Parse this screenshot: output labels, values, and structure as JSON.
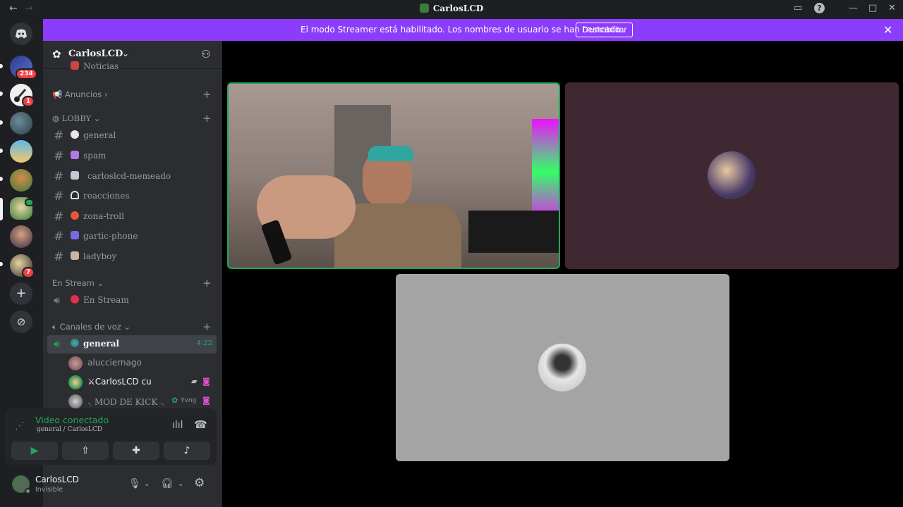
{
  "window": {
    "title": "CarlosLCD"
  },
  "banner": {
    "message": "El modo Streamer está habilitado. Los nombres de usuario se han truncado.",
    "button": "Deshabilitar"
  },
  "rail": {
    "badges": {
      "server1": "234",
      "server2": "1",
      "server8": "7"
    }
  },
  "server": {
    "name": "CarlosLCD"
  },
  "sidebar": {
    "partial_channel": "Noticias",
    "categories": {
      "anuncios": "Anuncios",
      "lobby": "LOBBY",
      "stream": "En Stream",
      "voz": "Canales de voz"
    },
    "channels": [
      {
        "label": "general"
      },
      {
        "label": "spam"
      },
      {
        "label": "carloslcd-memeado"
      },
      {
        "label": "reacciones"
      },
      {
        "label": "zona-troll"
      },
      {
        "label": "gartic-phone"
      },
      {
        "label": "ladyboy"
      }
    ],
    "stream_channel": "En Stream",
    "voice_channel": {
      "label": "general",
      "timer": "4:22"
    },
    "voice_users": [
      {
        "name": "alucciernago"
      },
      {
        "name": "⚔CarlosLCD cu"
      },
      {
        "name": "⸜ MOD DE KICK ⸜",
        "tag": "Yvng"
      }
    ]
  },
  "voice_panel": {
    "status": "Video conectado",
    "sub": "general / CarlosLCD"
  },
  "user": {
    "name": "CarlosLCD",
    "status": "Invisible"
  },
  "colors": {
    "accent": "#8c3dfb",
    "speaking": "#23a55a",
    "background": "#000000"
  }
}
